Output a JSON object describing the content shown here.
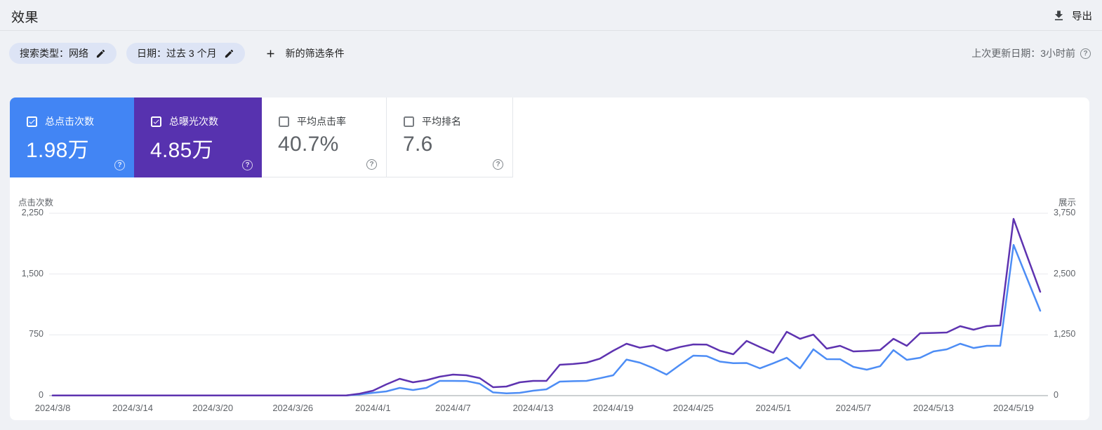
{
  "page": {
    "title": "效果"
  },
  "toolbar": {
    "export_label": "导出"
  },
  "filters": {
    "chips": [
      {
        "label": "搜索类型：网络"
      },
      {
        "label": "日期：过去 3 个月"
      }
    ],
    "add_filter_label": "新的筛选条件",
    "last_updated": "上次更新日期：3小时前"
  },
  "metrics": {
    "cards": [
      {
        "label": "总点击次数",
        "value": "1.98万",
        "checked": true,
        "color": "#4285f4"
      },
      {
        "label": "总曝光次数",
        "value": "4.85万",
        "checked": true,
        "color": "#5732af"
      },
      {
        "label": "平均点击率",
        "value": "40.7%",
        "checked": false,
        "color": "#ffffff"
      },
      {
        "label": "平均排名",
        "value": "7.6",
        "checked": false,
        "color": "#ffffff"
      }
    ]
  },
  "chart_data": {
    "type": "line",
    "grid": "horizontal",
    "legend_position": "none",
    "left_axis": {
      "title": "点击次数",
      "ticks": [
        "0",
        "750",
        "1,500",
        "2,250"
      ],
      "range": [
        0,
        2250
      ]
    },
    "right_axis": {
      "title": "展示",
      "ticks": [
        "0",
        "1,250",
        "2,500",
        "3,750"
      ],
      "range": [
        0,
        3750
      ]
    },
    "x_tick_labels": [
      "2024/3/8",
      "2024/3/14",
      "2024/3/20",
      "2024/3/26",
      "2024/4/1",
      "2024/4/7",
      "2024/4/13",
      "2024/4/19",
      "2024/4/25",
      "2024/5/1",
      "2024/5/7",
      "2024/5/13",
      "2024/5/19"
    ],
    "x_tick_day_step": 6,
    "dates": [
      "2024/3/8",
      "2024/3/9",
      "2024/3/10",
      "2024/3/11",
      "2024/3/12",
      "2024/3/13",
      "2024/3/14",
      "2024/3/15",
      "2024/3/16",
      "2024/3/17",
      "2024/3/18",
      "2024/3/19",
      "2024/3/20",
      "2024/3/21",
      "2024/3/22",
      "2024/3/23",
      "2024/3/24",
      "2024/3/25",
      "2024/3/26",
      "2024/3/27",
      "2024/3/28",
      "2024/3/29",
      "2024/3/30",
      "2024/3/31",
      "2024/4/1",
      "2024/4/2",
      "2024/4/3",
      "2024/4/4",
      "2024/4/5",
      "2024/4/6",
      "2024/4/7",
      "2024/4/8",
      "2024/4/9",
      "2024/4/10",
      "2024/4/11",
      "2024/4/12",
      "2024/4/13",
      "2024/4/14",
      "2024/4/15",
      "2024/4/16",
      "2024/4/17",
      "2024/4/18",
      "2024/4/19",
      "2024/4/20",
      "2024/4/21",
      "2024/4/22",
      "2024/4/23",
      "2024/4/24",
      "2024/4/25",
      "2024/4/26",
      "2024/4/27",
      "2024/4/28",
      "2024/4/29",
      "2024/4/30",
      "2024/5/1",
      "2024/5/2",
      "2024/5/3",
      "2024/5/4",
      "2024/5/5",
      "2024/5/6",
      "2024/5/7",
      "2024/5/8",
      "2024/5/9",
      "2024/5/10",
      "2024/5/11",
      "2024/5/12",
      "2024/5/13",
      "2024/5/14",
      "2024/5/15",
      "2024/5/16",
      "2024/5/17",
      "2024/5/18",
      "2024/5/19",
      "2024/5/20",
      "2024/5/21"
    ],
    "series": [
      {
        "name": "点击次数",
        "axis": "left",
        "color": "#4d8df5",
        "values": [
          2,
          2,
          2,
          2,
          2,
          2,
          2,
          2,
          2,
          2,
          2,
          2,
          2,
          2,
          2,
          2,
          2,
          2,
          2,
          2,
          2,
          2,
          2,
          15,
          35,
          52,
          95,
          69,
          95,
          182,
          182,
          180,
          147,
          40,
          28,
          35,
          61,
          78,
          173,
          178,
          182,
          215,
          251,
          445,
          407,
          340,
          260,
          380,
          493,
          488,
          420,
          400,
          402,
          337,
          400,
          467,
          337,
          571,
          450,
          449,
          355,
          320,
          363,
          562,
          441,
          467,
          545,
          571,
          640,
          588,
          614,
          614,
          1860,
          1450,
          1047
        ]
      },
      {
        "name": "展示",
        "axis": "right",
        "color": "#5e33b0",
        "values": [
          5,
          5,
          5,
          5,
          5,
          5,
          5,
          5,
          5,
          5,
          5,
          5,
          5,
          5,
          5,
          5,
          5,
          5,
          5,
          5,
          5,
          5,
          5,
          40,
          101,
          231,
          346,
          274,
          317,
          389,
          433,
          418,
          361,
          173,
          187,
          274,
          303,
          303,
          634,
          650,
          678,
          760,
          923,
          1067,
          985,
          1030,
          923,
          1000,
          1053,
          1048,
          923,
          851,
          1125,
          1000,
          880,
          1312,
          1168,
          1255,
          966,
          1024,
          908,
          920,
          937,
          1168,
          1024,
          1284,
          1290,
          1298,
          1428,
          1356,
          1428,
          1442,
          3634,
          2880,
          2134
        ]
      }
    ]
  }
}
